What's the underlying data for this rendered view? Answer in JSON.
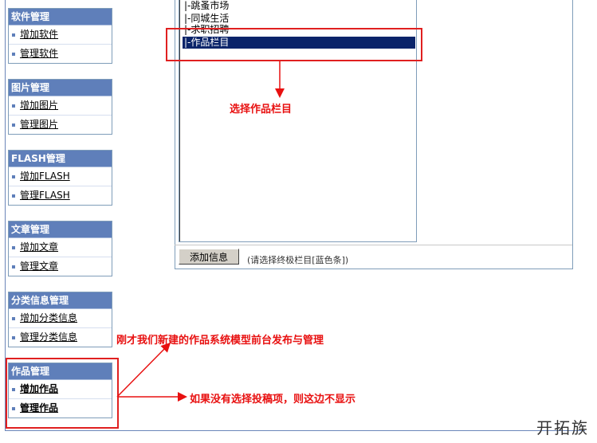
{
  "sidebar": {
    "groups": [
      {
        "title": "软件管理",
        "items": [
          "增加软件",
          "管理软件"
        ]
      },
      {
        "title": "图片管理",
        "items": [
          "增加图片",
          "管理图片"
        ]
      },
      {
        "title": "FLASH管理",
        "items": [
          "增加FLASH",
          "管理FLASH"
        ]
      },
      {
        "title": "文章管理",
        "items": [
          "增加文章",
          "管理文章"
        ]
      },
      {
        "title": "分类信息管理",
        "items": [
          "增加分类信息",
          "管理分类信息"
        ]
      },
      {
        "title": "作品管理",
        "items": [
          "增加作品",
          "管理作品"
        ]
      }
    ]
  },
  "category_list": {
    "options": [
      "|-跳蚤市场",
      "|-同城生活",
      "|-求职招聘",
      "|-作品栏目"
    ],
    "selected": "|-作品栏目"
  },
  "form": {
    "add_button": "添加信息",
    "hint": "(请选择终极栏目[蓝色条])"
  },
  "annotations": {
    "select_column": "选择作品栏目",
    "new_model_note": "刚才我们新建的作品系统模型前台发布与管理",
    "no_submit_note": "如果没有选择投稿项，则这边不显示"
  },
  "watermark": "开拓族",
  "colors": {
    "annotation": "#e81010",
    "selection": "#0a246a",
    "menu_header": "#5f7fba"
  }
}
